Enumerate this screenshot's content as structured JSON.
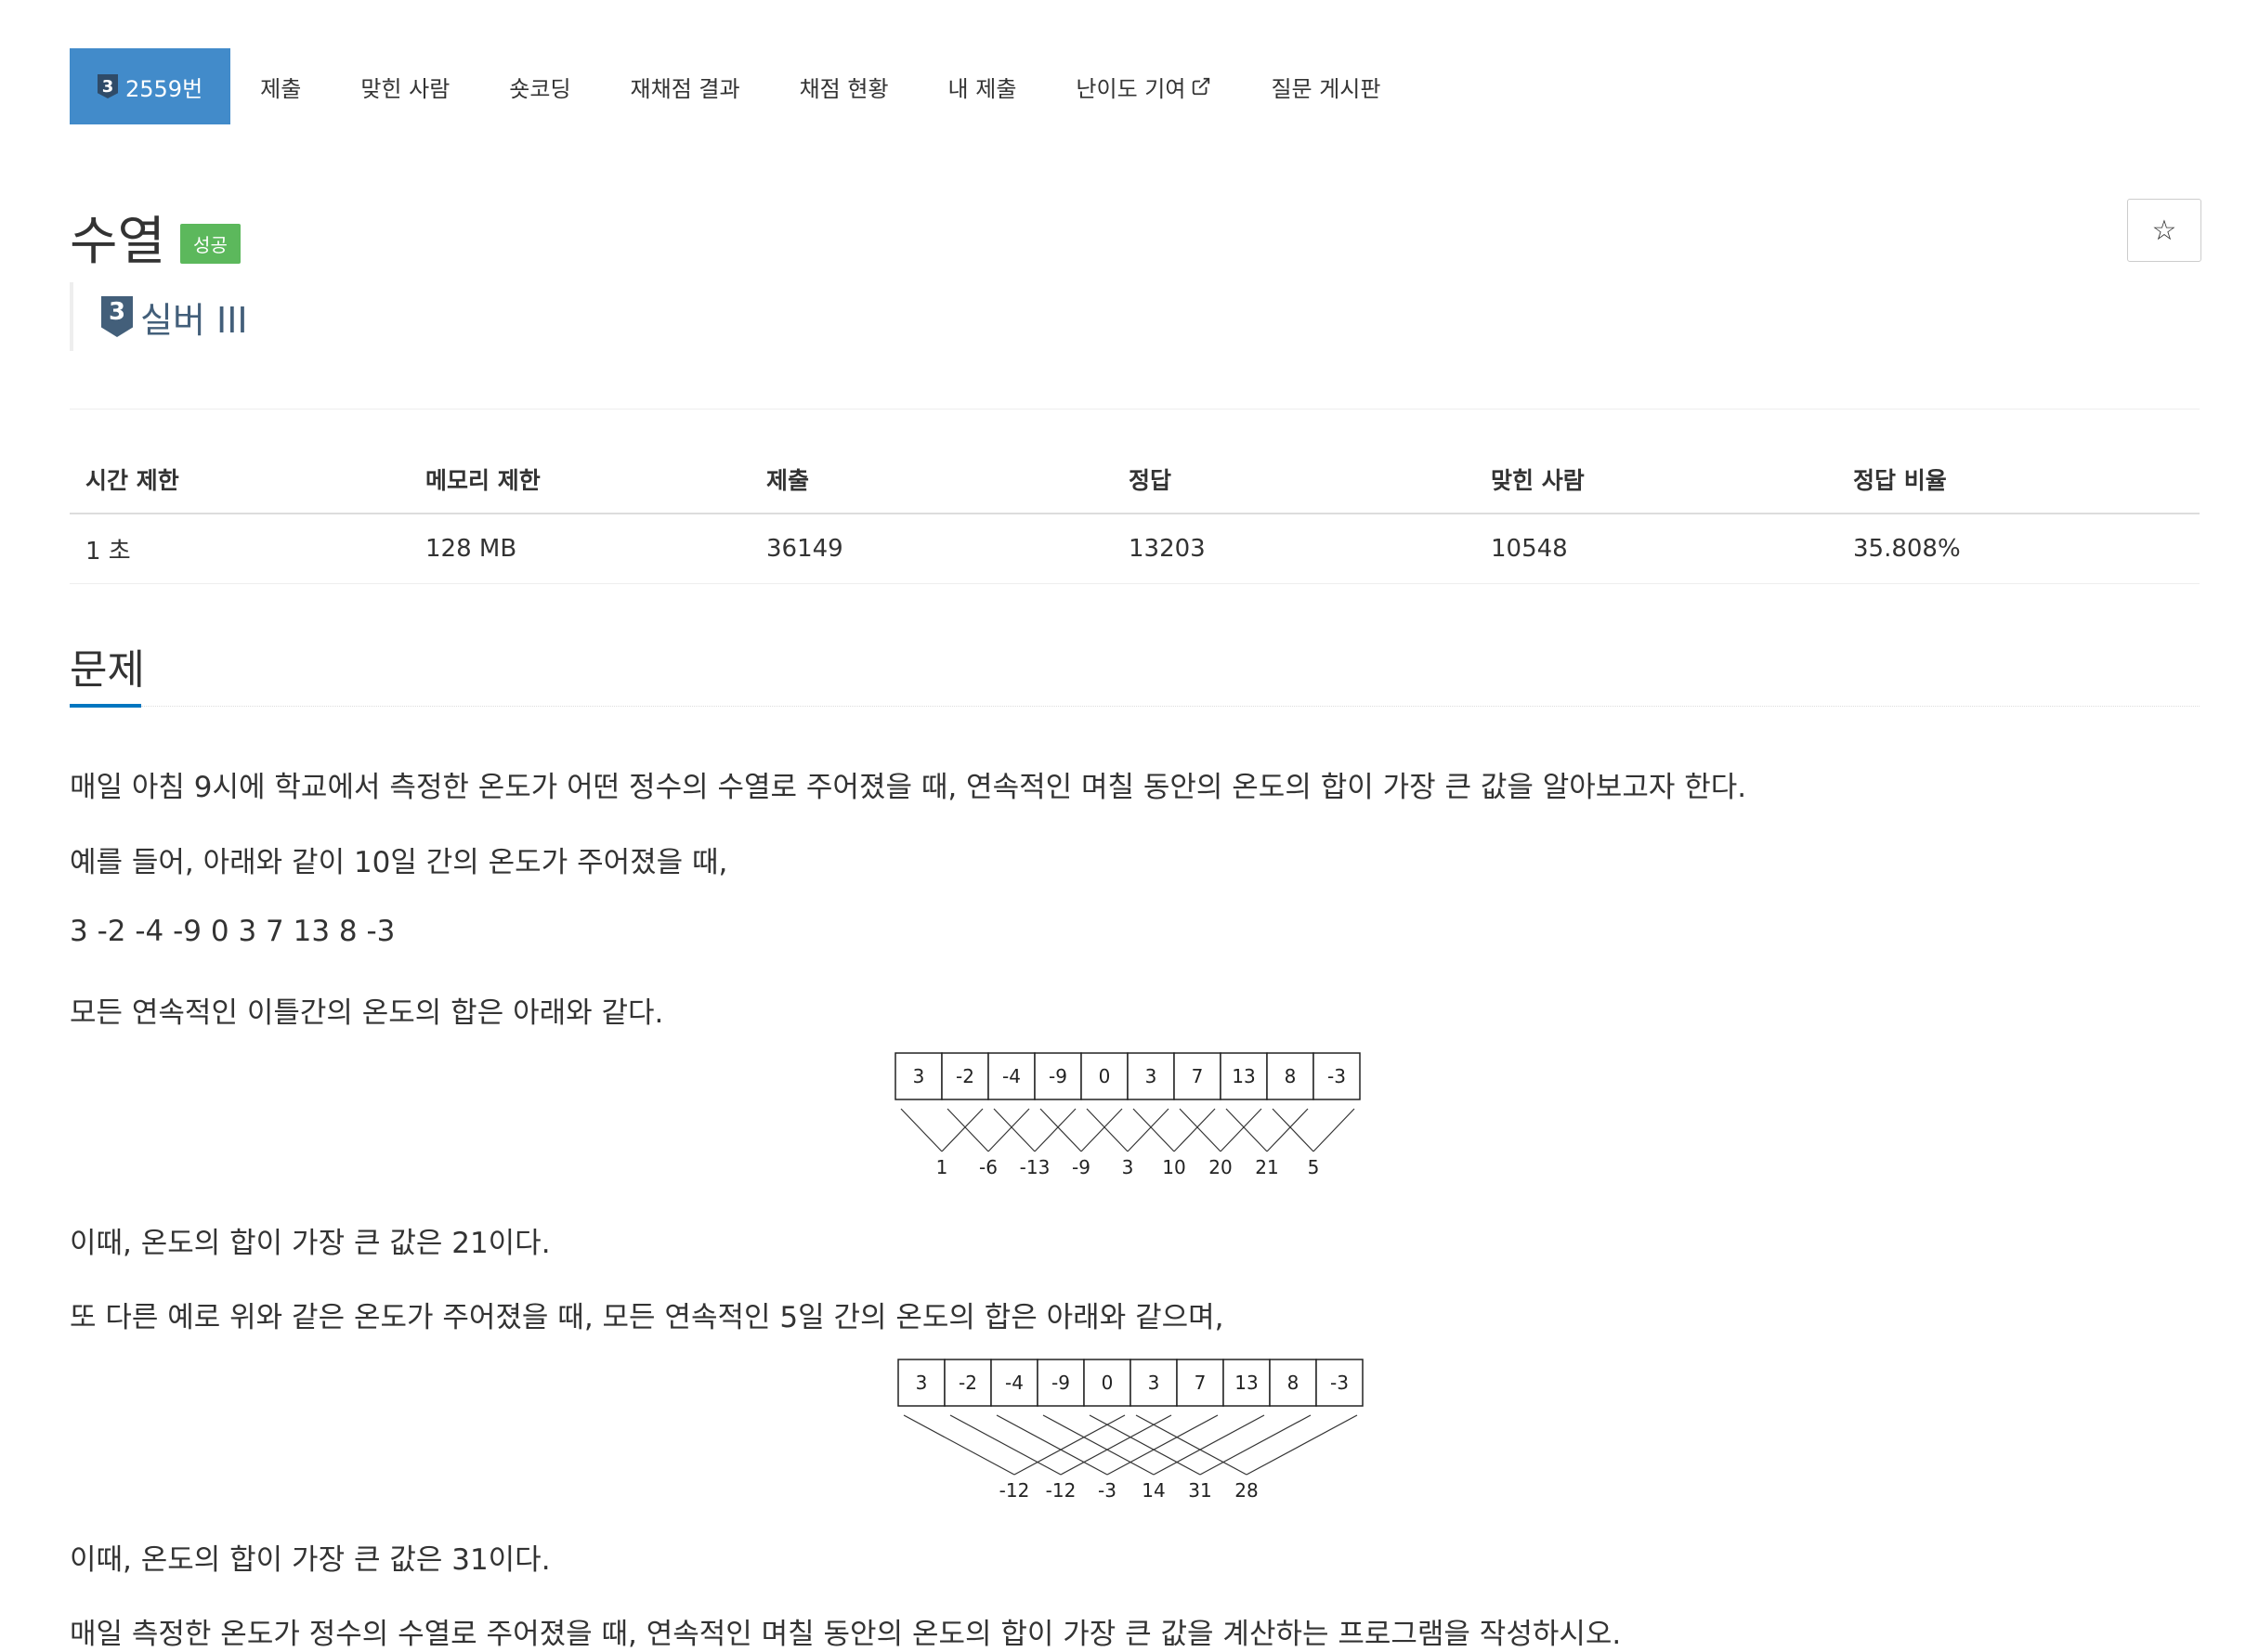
{
  "nav": {
    "problem_tab": {
      "tier_digit": "3",
      "label": "2559번"
    },
    "items": [
      "제출",
      "맞힌 사람",
      "숏코딩",
      "재채점 결과",
      "채점 현황",
      "내 제출",
      "난이도 기여",
      "질문 게시판"
    ]
  },
  "header": {
    "title": "수열",
    "result_badge": "성공",
    "tier_digit": "3",
    "tier": "실버 III",
    "star": "☆"
  },
  "stats": {
    "headers": [
      "시간 제한",
      "메모리 제한",
      "제출",
      "정답",
      "맞힌 사람",
      "정답 비율"
    ],
    "values": [
      "1 초",
      "128 MB",
      "36149",
      "13203",
      "10548",
      "35.808%"
    ]
  },
  "problem": {
    "section_title": "문제",
    "p1": "매일 아침 9시에 학교에서 측정한 온도가 어떤 정수의 수열로 주어졌을 때, 연속적인 며칠 동안의 온도의 합이 가장 큰 값을 알아보고자 한다.",
    "p2": "예를 들어, 아래와 같이 10일 간의 온도가 주어졌을 때,",
    "p3": "3 -2 -4 -9 0 3 7 13 8 -3",
    "p4": "모든 연속적인 이틀간의 온도의 합은 아래와 같다.",
    "p5": "이때, 온도의 합이 가장 큰 값은 21이다.",
    "p6": "또 다른 예로 위와 같은 온도가 주어졌을 때, 모든 연속적인 5일 간의 온도의 합은 아래와 같으며,",
    "p7": "이때, 온도의 합이 가장 큰 값은 31이다.",
    "p8": "매일 측정한 온도가 정수의 수열로 주어졌을 때, 연속적인 며칠 동안의 온도의 합이 가장 큰 값을 계산하는 프로그램을 작성하시오."
  },
  "diagram1": {
    "cells": [
      "3",
      "-2",
      "-4",
      "-9",
      "0",
      "3",
      "7",
      "13",
      "8",
      "-3"
    ],
    "sums": [
      "1",
      "-6",
      "-13",
      "-9",
      "3",
      "10",
      "20",
      "21",
      "5"
    ],
    "window": 2
  },
  "diagram2": {
    "cells": [
      "3",
      "-2",
      "-4",
      "-9",
      "0",
      "3",
      "7",
      "13",
      "8",
      "-3"
    ],
    "sums": [
      "-12",
      "-12",
      "-3",
      "14",
      "31",
      "28"
    ],
    "window": 5
  }
}
